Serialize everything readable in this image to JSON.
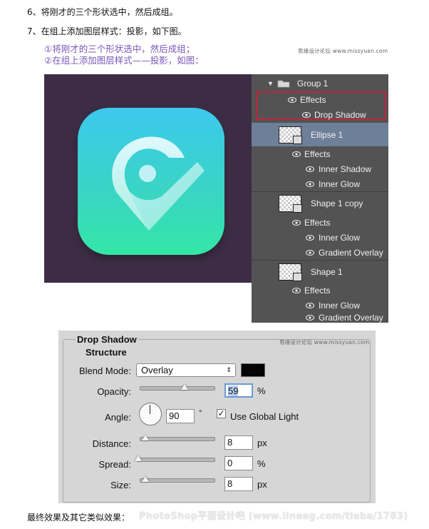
{
  "steps": {
    "step6": "6、将刚才的三个形状选中，然后成组。",
    "step7": "7、在组上添加图层样式：投影，如下图。"
  },
  "figure": {
    "note1": "①将刚才的三个形状选中，然后成组；",
    "note2": "②在组上添加图层样式——投影，如图：",
    "watermark": "思缘设计论坛 www.missyuan.com"
  },
  "layers": {
    "group": "Group 1",
    "group_effects": "Effects",
    "drop_shadow": "Drop Shadow",
    "ellipse": "Ellipse 1",
    "ellipse_effects": "Effects",
    "inner_shadow": "Inner Shadow",
    "ellipse_inner_glow": "Inner Glow",
    "shape_copy": "Shape 1 copy",
    "shape_copy_effects": "Effects",
    "shape_copy_inner_glow": "Inner Glow",
    "shape_copy_gradient": "Gradient Overlay",
    "shape": "Shape 1",
    "shape_effects": "Effects",
    "shape_inner_glow": "Inner Glow",
    "shape_gradient": "Gradient Overlay"
  },
  "dialog": {
    "title": "Drop Shadow",
    "structure": "Structure",
    "watermark": "思缘设计论坛 www.missyuan.com",
    "blend_mode_label": "Blend Mode:",
    "blend_mode_value": "Overlay",
    "opacity_label": "Opacity:",
    "opacity_value": "59",
    "opacity_unit": "%",
    "angle_label": "Angle:",
    "angle_value": "90",
    "angle_unit": "°",
    "global_light_label": "Use Global Light",
    "global_light_checked": "✓",
    "distance_label": "Distance:",
    "distance_value": "8",
    "distance_unit": "px",
    "spread_label": "Spread:",
    "spread_value": "0",
    "spread_unit": "%",
    "size_label": "Size:",
    "size_value": "8",
    "size_unit": "px",
    "shadow_color": "#050505"
  },
  "caption": "最终效果及其它类似效果：",
  "footer_watermark": "PhotoShop平面设计吧 (www.lineeg.com/tieba/1783)"
}
